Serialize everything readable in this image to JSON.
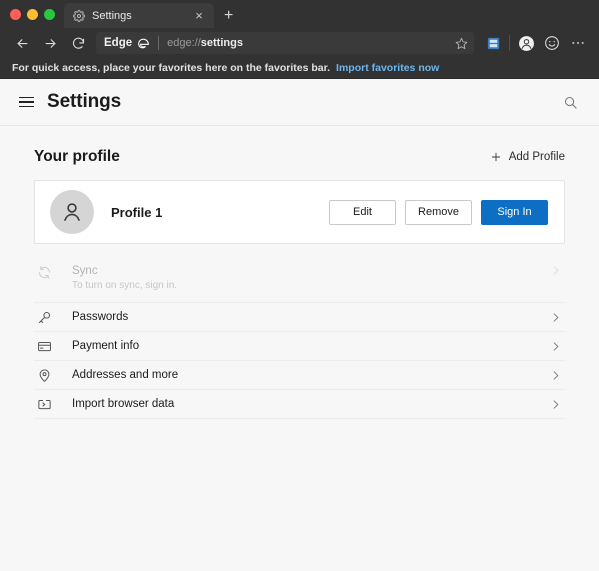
{
  "window": {
    "traffic_lights": [
      "close",
      "minimize",
      "maximize"
    ]
  },
  "tab": {
    "title": "Settings",
    "favicon": "gear-icon",
    "close_label": "×",
    "new_tab_label": "+"
  },
  "toolbar": {
    "back_label": "back-arrow",
    "forward_label": "forward-arrow",
    "reload_label": "reload",
    "brand_label": "Edge",
    "brand_logo": "edge-logo",
    "url_scheme": "edge://",
    "url_path": "settings",
    "favorite_label": "star-icon",
    "collections_label": "collections-icon",
    "profile_label": "profile-icon",
    "feedback_label": "smiley-icon",
    "more_label": "more-icon"
  },
  "favorites_bar": {
    "message": "For quick access, place your favorites here on the favorites bar.",
    "link": "Import favorites now",
    "link_color": "#6bb6f0"
  },
  "page": {
    "menu_label": "hamburger-menu",
    "title": "Settings",
    "search_label": "search-icon"
  },
  "profile_section": {
    "heading": "Your profile",
    "add_profile_label": "Add Profile",
    "add_profile_icon": "plus-icon",
    "card": {
      "avatar_icon": "person-icon",
      "name": "Profile 1",
      "buttons": [
        {
          "label": "Edit",
          "style": "secondary"
        },
        {
          "label": "Remove",
          "style": "secondary"
        },
        {
          "label": "Sign In",
          "style": "primary",
          "color": "#0c6fc4"
        }
      ]
    },
    "rows": [
      {
        "label": "Sync",
        "sublabel": "To turn on sync, sign in.",
        "icon": "sync-icon",
        "disabled": true
      },
      {
        "label": "Passwords",
        "sublabel": "",
        "icon": "key-icon",
        "disabled": false
      },
      {
        "label": "Payment info",
        "sublabel": "",
        "icon": "credit-card-icon",
        "disabled": false
      },
      {
        "label": "Addresses and more",
        "sublabel": "",
        "icon": "location-pin-icon",
        "disabled": false
      },
      {
        "label": "Import browser data",
        "sublabel": "",
        "icon": "import-icon",
        "disabled": false
      }
    ]
  }
}
